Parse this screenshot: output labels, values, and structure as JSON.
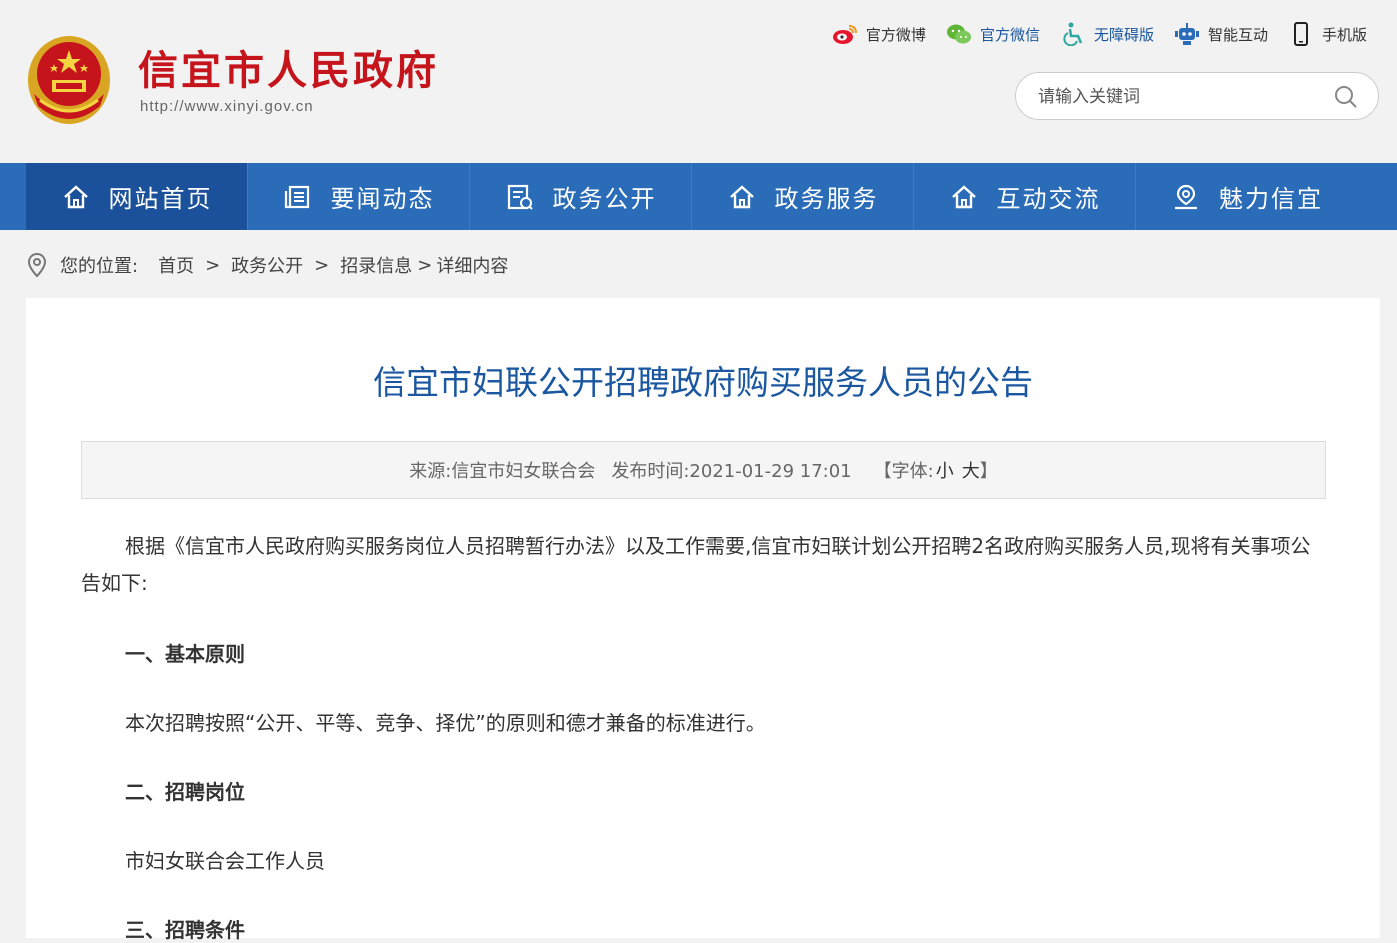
{
  "header": {
    "site_title": "信宜市人民政府",
    "site_url": "http://www.xinyi.gov.cn",
    "links": [
      {
        "label": "官方微博",
        "icon": "weibo-icon"
      },
      {
        "label": "官方微信",
        "icon": "wechat-icon"
      },
      {
        "label": "无障碍版",
        "icon": "accessibility-icon"
      },
      {
        "label": "智能互动",
        "icon": "robot-icon"
      },
      {
        "label": "手机版",
        "icon": "mobile-icon"
      }
    ],
    "search_placeholder": "请输入关键词"
  },
  "nav": {
    "items": [
      {
        "label": "网站首页",
        "icon": "home-icon"
      },
      {
        "label": "要闻动态",
        "icon": "news-icon"
      },
      {
        "label": "政务公开",
        "icon": "document-icon"
      },
      {
        "label": "政务服务",
        "icon": "home-icon"
      },
      {
        "label": "互动交流",
        "icon": "home-icon"
      },
      {
        "label": "魅力信宜",
        "icon": "location-user-icon"
      }
    ],
    "active_index": 0
  },
  "breadcrumb": {
    "label": "您的位置:",
    "items": [
      "首页",
      "政务公开",
      "招录信息",
      "详细内容"
    ]
  },
  "article": {
    "title": "信宜市妇联公开招聘政府购买服务人员的公告",
    "source": "来源:信宜市妇女联合会",
    "published": "发布时间:2021-01-29 17:01",
    "font_prefix": "【字体:",
    "font_small": "小",
    "font_large": "大",
    "font_suffix": "】",
    "paragraphs": [
      "根据《信宜市人民政府购买服务岗位人员招聘暂行办法》以及工作需要,信宜市妇联计划公开招聘2名政府购买服务人员,现将有关事项公告如下:",
      "一、基本原则",
      "本次招聘按照“公开、平等、竞争、择优”的原则和德才兼备的标准进行。",
      "二、招聘岗位",
      "市妇女联合会工作人员",
      "三、招聘条件"
    ]
  },
  "colors": {
    "brand_red": "#c5141b",
    "nav_blue": "#2a6cb8",
    "nav_active": "#1a519a",
    "title_blue": "#1a57a0"
  }
}
